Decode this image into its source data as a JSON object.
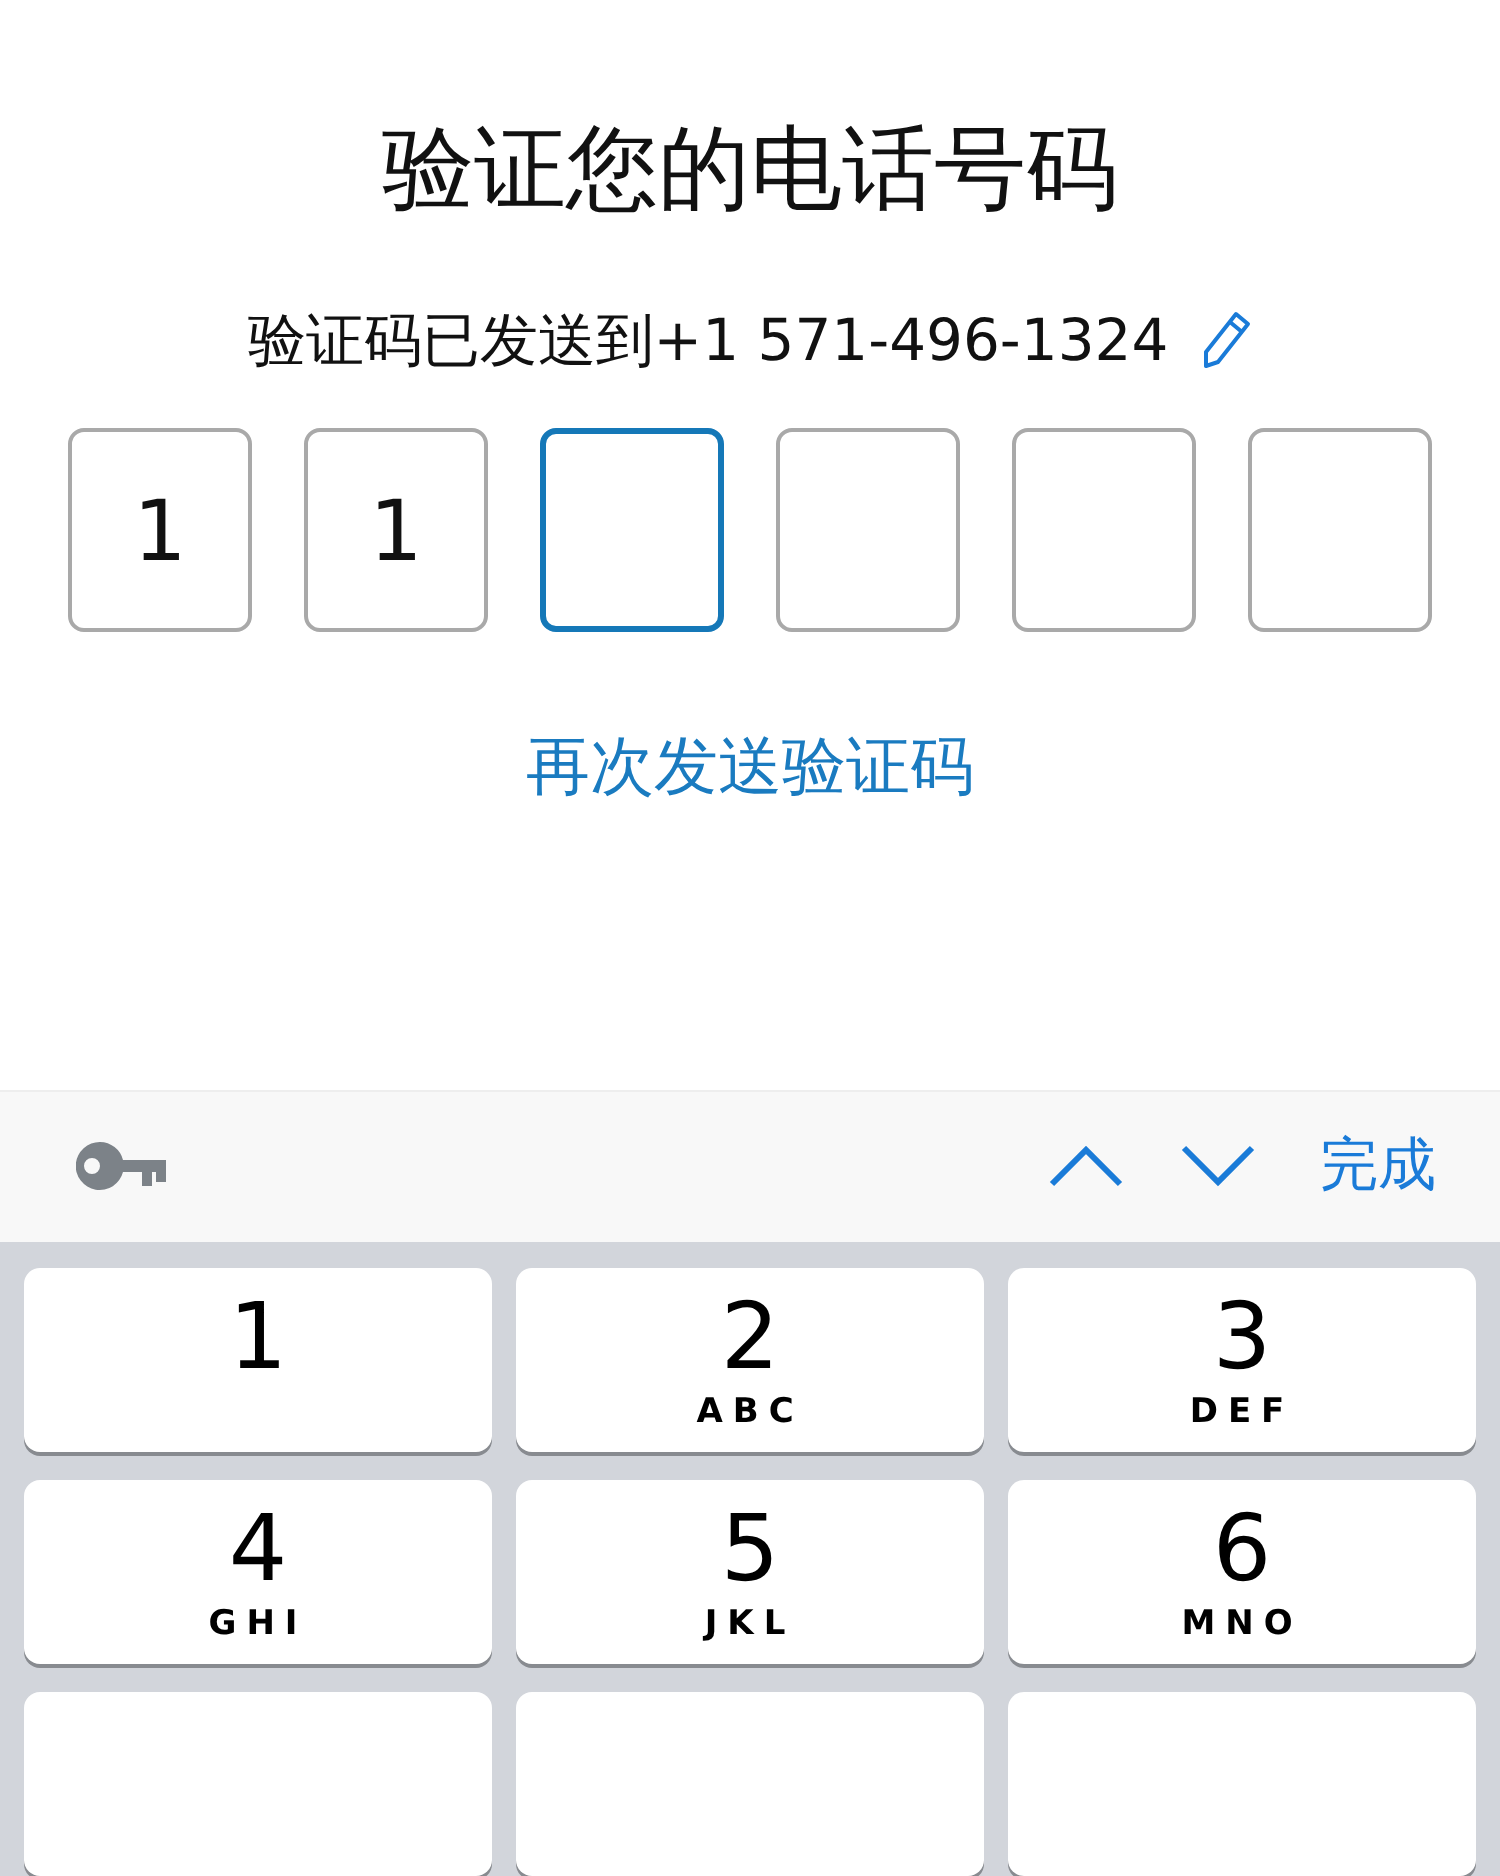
{
  "title": "验证您的电话号码",
  "subtitle": "验证码已发送到+1 571-496-1324",
  "code_boxes": [
    {
      "value": "1",
      "selected": false
    },
    {
      "value": "1",
      "selected": false
    },
    {
      "selected": true
    },
    {
      "selected": false
    },
    {
      "selected": false
    },
    {
      "selected": false
    }
  ],
  "resend_link": "再次发送验证码",
  "accessory_bar": {
    "done": "完成"
  },
  "keypad": [
    {
      "digit": "1"
    },
    {
      "digit": "2",
      "letters": "ABC"
    },
    {
      "digit": "3",
      "letters": "DEF"
    },
    {
      "digit": "4",
      "letters": "GHI"
    },
    {
      "digit": "5",
      "letters": "JKL"
    },
    {
      "digit": "6",
      "letters": "MNO"
    }
  ]
}
